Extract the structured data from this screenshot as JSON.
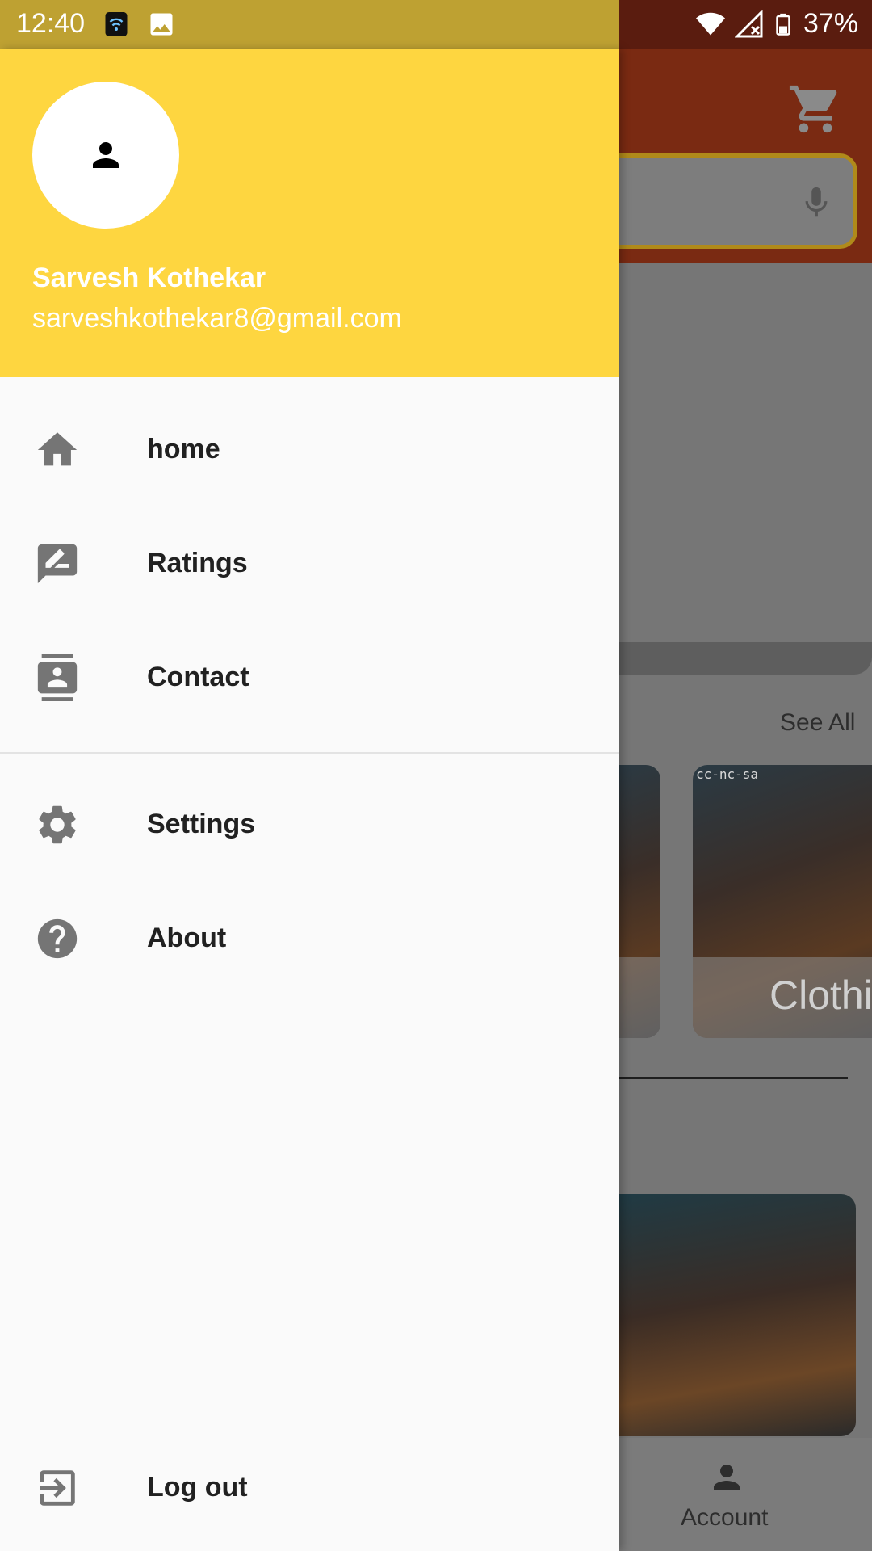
{
  "status_bar": {
    "time": "12:40",
    "battery_percent": "37%",
    "icons": [
      "wifi-calling-icon",
      "image-icon",
      "wifi-icon",
      "signal-icon",
      "battery-icon"
    ]
  },
  "background_app": {
    "see_all_label": "See All",
    "card_label": "Clothi",
    "card_tag": "cc-nc-sa",
    "bottom_nav": {
      "account_label": "Account"
    },
    "icons": [
      "cart-icon",
      "mic-icon",
      "account-icon"
    ]
  },
  "drawer": {
    "header": {
      "name": "Sarvesh Kothekar",
      "email": "sarveshkothekar8@gmail.com",
      "avatar_icon": "person-icon",
      "color": "#fed640"
    },
    "items": [
      {
        "label": "home",
        "icon": "home-icon"
      },
      {
        "label": "Ratings",
        "icon": "rate-review-icon"
      },
      {
        "label": "Contact",
        "icon": "contact-icon"
      },
      {
        "label": "Settings",
        "icon": "gear-icon"
      },
      {
        "label": "About",
        "icon": "help-icon"
      }
    ],
    "logout": {
      "label": "Log out",
      "icon": "logout-icon"
    }
  }
}
